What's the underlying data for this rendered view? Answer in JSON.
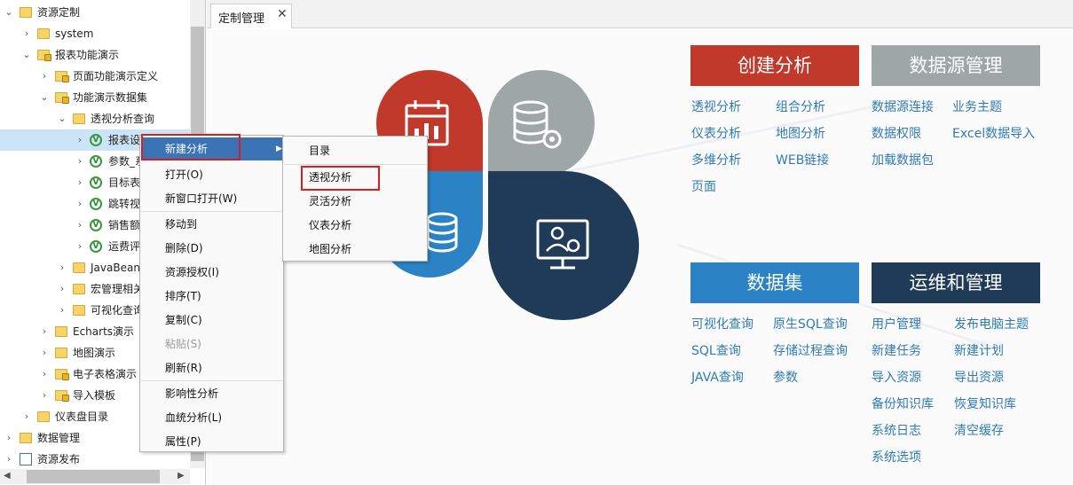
{
  "tree": {
    "items": [
      {
        "label": "资源定制",
        "expanded": true,
        "icon": "folder"
      },
      {
        "label": "system",
        "expanded": false,
        "icon": "folder"
      },
      {
        "label": "报表功能演示",
        "expanded": true,
        "icon": "folder-lock"
      },
      {
        "label": "页面功能演示定义",
        "expanded": false,
        "icon": "folder-lock"
      },
      {
        "label": "功能演示数据集",
        "expanded": true,
        "icon": "folder-lock"
      },
      {
        "label": "透视分析查询",
        "expanded": true,
        "icon": "folder"
      },
      {
        "label": "报表设",
        "expanded": false,
        "icon": "visual-query"
      },
      {
        "label": "参数_系",
        "expanded": false,
        "icon": "visual-query"
      },
      {
        "label": "目标表",
        "expanded": false,
        "icon": "visual-query"
      },
      {
        "label": "跳转视",
        "expanded": false,
        "icon": "visual-query"
      },
      {
        "label": "销售额",
        "expanded": false,
        "icon": "visual-query"
      },
      {
        "label": "运费评",
        "expanded": false,
        "icon": "visual-query"
      },
      {
        "label": "JavaBean查",
        "expanded": false,
        "icon": "folder"
      },
      {
        "label": "宏管理相关",
        "expanded": false,
        "icon": "folder"
      },
      {
        "label": "可视化查询",
        "expanded": false,
        "icon": "folder"
      },
      {
        "label": "Echarts演示",
        "expanded": false,
        "icon": "folder"
      },
      {
        "label": "地图演示",
        "expanded": false,
        "icon": "folder"
      },
      {
        "label": "电子表格演示",
        "expanded": false,
        "icon": "folder-lock"
      },
      {
        "label": "导入模板",
        "expanded": false,
        "icon": "folder-lock"
      },
      {
        "label": "仪表盘目录",
        "expanded": false,
        "icon": "folder"
      },
      {
        "label": "数据管理",
        "expanded": false,
        "icon": "folder"
      },
      {
        "label": "资源发布",
        "expanded": false,
        "icon": "edit-doc"
      }
    ],
    "selected_index": 6
  },
  "tab": {
    "label": "定制管理",
    "close_glyph": "✕"
  },
  "context_menu": {
    "items": [
      {
        "label": "新建分析",
        "submenu": true,
        "active": true
      },
      {
        "label": "打开(O)"
      },
      {
        "label": "新窗口打开(W)"
      },
      {
        "label": "移动到"
      },
      {
        "label": "删除(D)"
      },
      {
        "label": "资源授权(I)"
      },
      {
        "label": "排序(T)"
      },
      {
        "label": "复制(C)"
      },
      {
        "label": "粘贴(S)",
        "disabled": true
      },
      {
        "label": "刷新(R)"
      },
      {
        "label": "影响性分析"
      },
      {
        "label": "血统分析(L)"
      },
      {
        "label": "属性(P)"
      }
    ]
  },
  "submenu": {
    "items": [
      {
        "label": "目录"
      },
      {
        "label": "透视分析",
        "highlighted": true
      },
      {
        "label": "灵活分析"
      },
      {
        "label": "仪表分析"
      },
      {
        "label": "地图分析"
      }
    ]
  },
  "dashboard": {
    "sections": [
      {
        "title": "创建分析",
        "color": "#c0392b",
        "links": [
          "透视分析",
          "组合分析",
          "仪表分析",
          "地图分析",
          "多维分析",
          "WEB链接",
          "页面"
        ]
      },
      {
        "title": "数据源管理",
        "color": "#9ea6a6",
        "links": [
          "数据源连接",
          "业务主题",
          "数据权限",
          "Excel数据导入",
          "加载数据包"
        ]
      },
      {
        "title": "数据集",
        "color": "#2b82c4",
        "links": [
          "可视化查询",
          "原生SQL查询",
          "SQL查询",
          "存储过程查询",
          "JAVA查询",
          "参数"
        ]
      },
      {
        "title": "运维和管理",
        "color": "#1f3b58",
        "links": [
          "用户管理",
          "发布电脑主题",
          "新建任务",
          "新建计划",
          "导入资源",
          "导出资源",
          "备份知识库",
          "恢复知识库",
          "系统日志",
          "清空缓存",
          "系统选项"
        ]
      }
    ],
    "petal_icons": [
      "calendar-chart-icon",
      "database-gear-icon",
      "database-icon",
      "monitor-user-gear-icon"
    ]
  }
}
